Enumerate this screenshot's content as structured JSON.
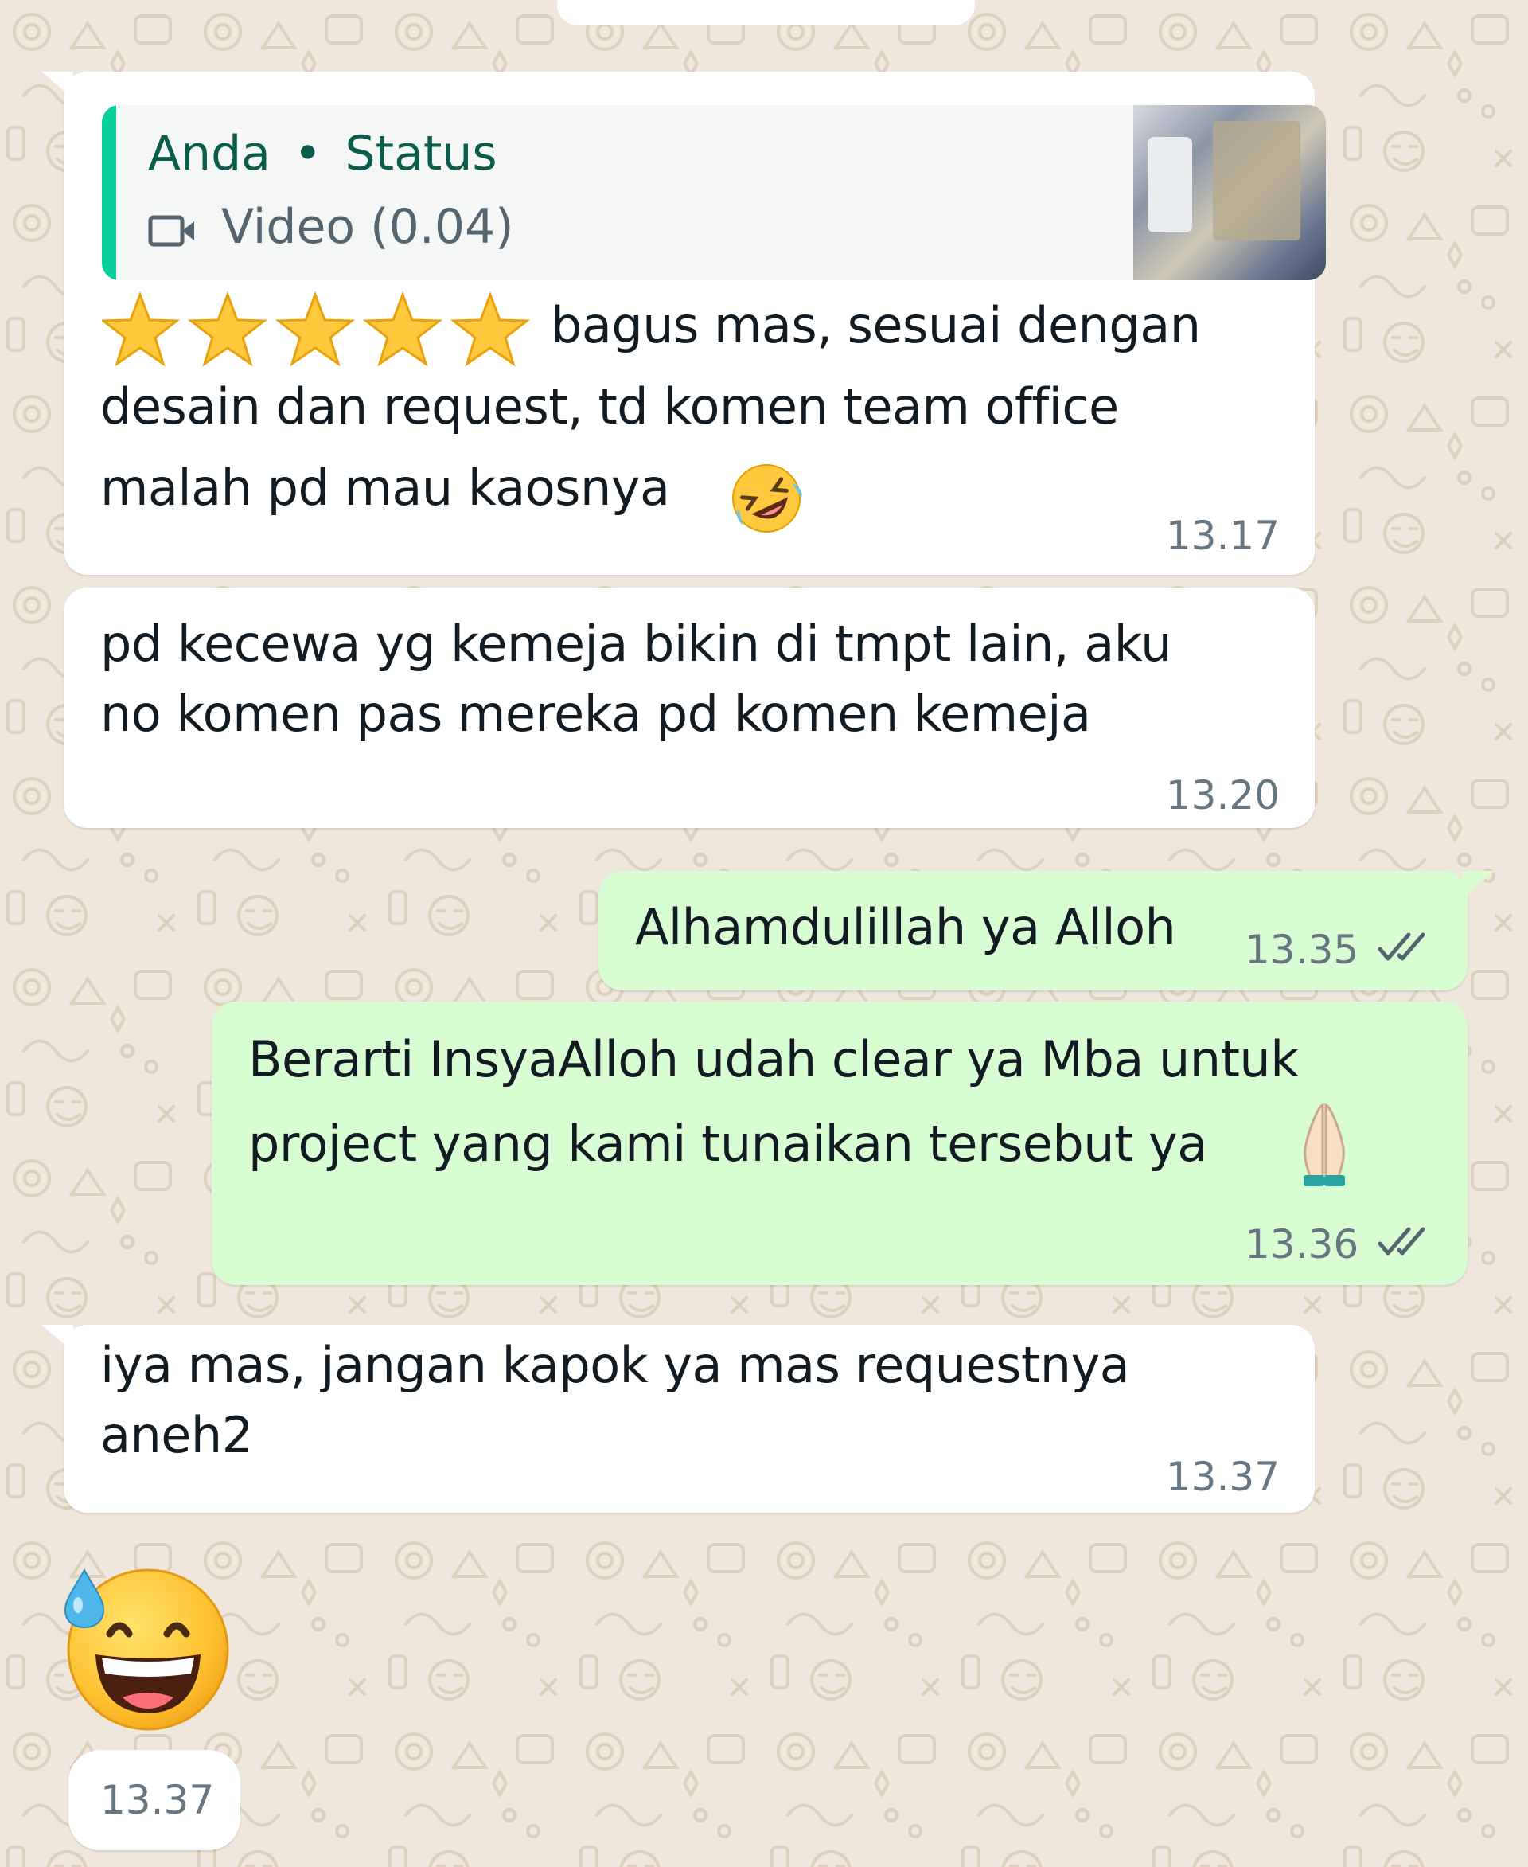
{
  "chat": {
    "colors": {
      "wallpaper": "#efe7dc",
      "incoming_bubble": "#ffffff",
      "outgoing_bubble": "#d9fdd3",
      "quote_accent": "#06cf9c",
      "read_ticks": "#53646e"
    },
    "messages": [
      {
        "direction": "incoming",
        "quote": {
          "author": "Anda",
          "separator": "•",
          "source": "Status",
          "media_label": "Video (0.04)",
          "media_icon": "video-camera-icon"
        },
        "rating_icon": "star-icon",
        "rating_value": 5,
        "rating_max": 5,
        "lines": [
          "bagus mas, sesuai dengan",
          "desain dan request, td komen team office",
          "malah pd mau kaosnya"
        ],
        "trailing_emoji": "rolling-on-floor-laughing-emoji",
        "time": "13.17"
      },
      {
        "direction": "incoming",
        "lines": [
          "pd kecewa yg kemeja bikin di tmpt lain, aku",
          "no komen pas mereka pd komen kemeja"
        ],
        "time": "13.20"
      },
      {
        "direction": "outgoing",
        "lines": [
          "Alhamdulillah ya Alloh"
        ],
        "time": "13.35",
        "status": "read-double-tick-icon"
      },
      {
        "direction": "outgoing",
        "lines": [
          "Berarti InsyaAlloh udah clear ya Mba untuk",
          "project yang kami tunaikan tersebut ya"
        ],
        "trailing_emoji": "folded-hands-emoji",
        "time": "13.36",
        "status": "read-double-tick-icon"
      },
      {
        "direction": "incoming",
        "lines": [
          "iya mas, jangan kapok ya mas requestnya",
          "aneh2"
        ],
        "time": "13.37"
      },
      {
        "direction": "incoming",
        "sticker_emoji": "grinning-face-with-sweat-emoji",
        "time": "13.37"
      }
    ]
  }
}
